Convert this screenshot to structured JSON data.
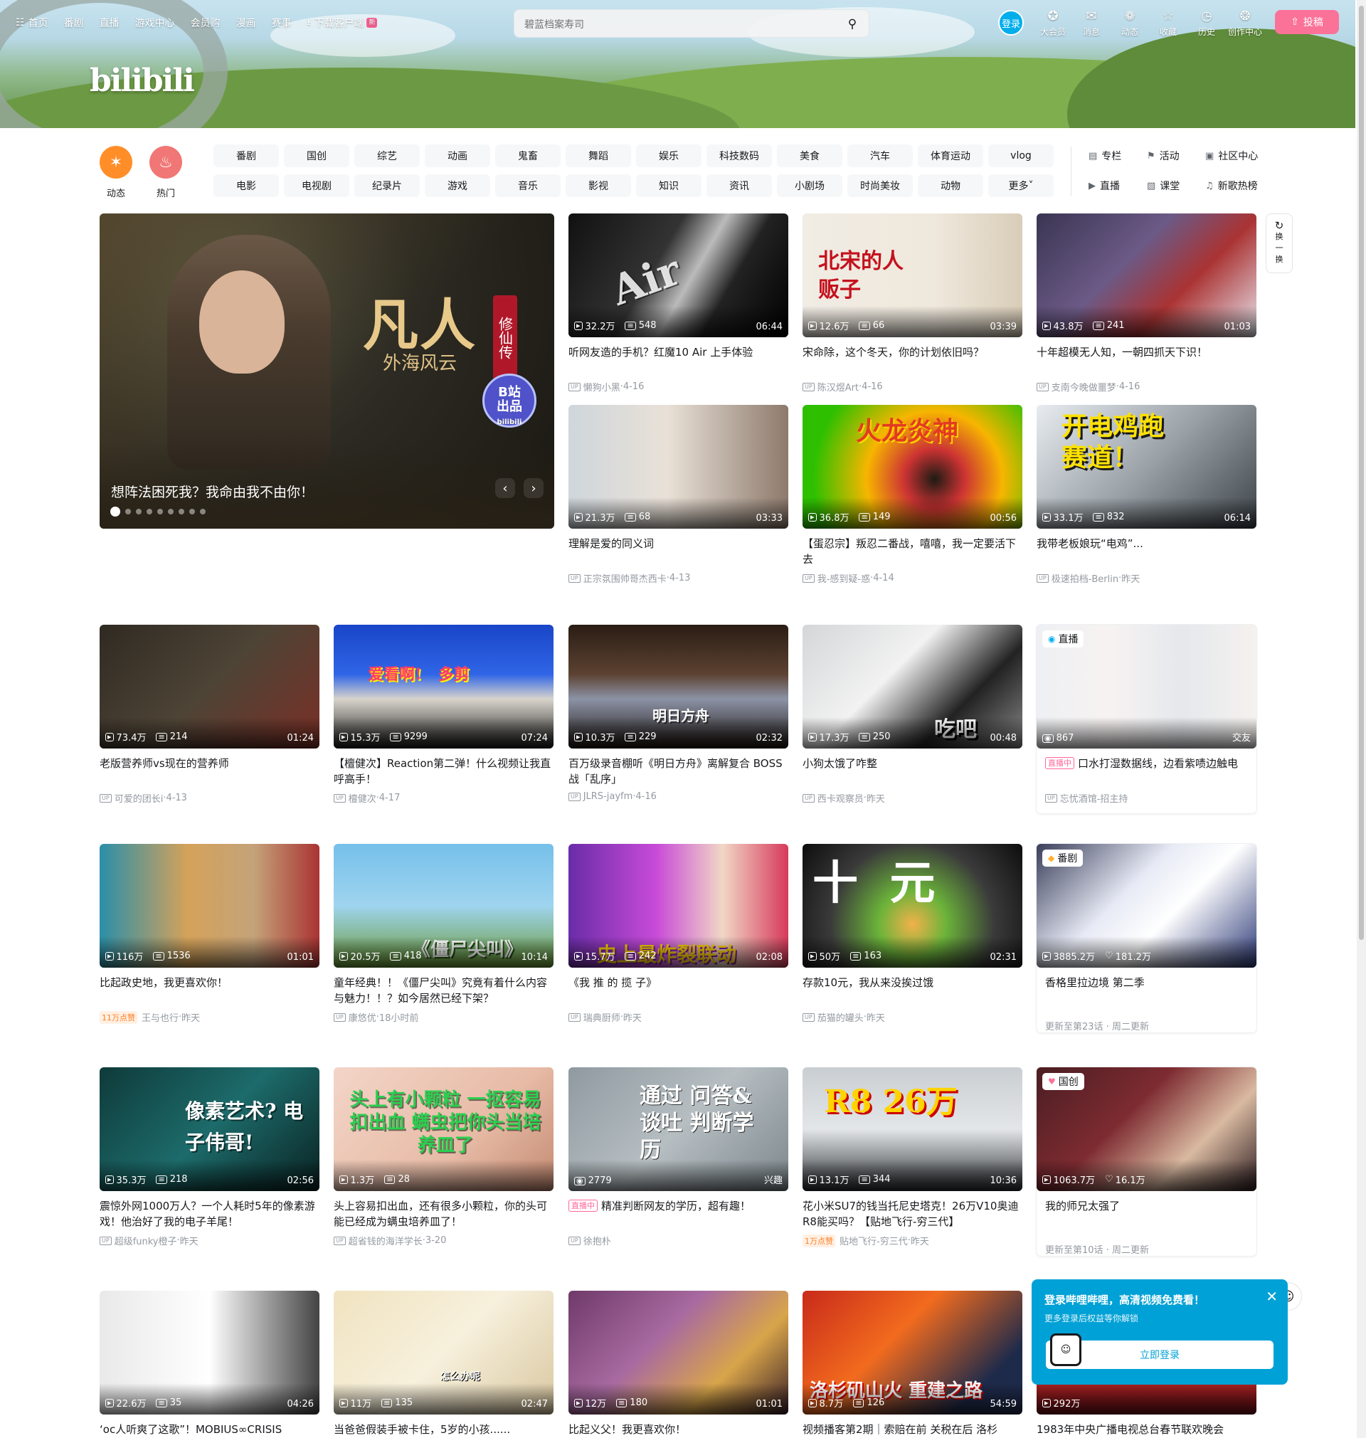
{
  "topnav": [
    {
      "icon": "tv-icon",
      "label": "首页"
    },
    {
      "icon": "",
      "label": "番剧"
    },
    {
      "icon": "",
      "label": "直播"
    },
    {
      "icon": "",
      "label": "游戏中心"
    },
    {
      "icon": "",
      "label": "会员购"
    },
    {
      "icon": "",
      "label": "漫画"
    },
    {
      "icon": "",
      "label": "赛事"
    },
    {
      "icon": "download-icon",
      "label": "下载客户端",
      "badge": "新"
    }
  ],
  "logo": "bilibili",
  "search": {
    "placeholder": "碧蓝档案寿司"
  },
  "login_label": "登录",
  "rightnav": [
    {
      "icon": "vip-icon",
      "label": "大会员"
    },
    {
      "icon": "message-icon",
      "label": "消息"
    },
    {
      "icon": "dynamic-icon",
      "label": "动态"
    },
    {
      "icon": "star-icon",
      "label": "收藏"
    },
    {
      "icon": "history-icon",
      "label": "历史"
    },
    {
      "icon": "bulb-icon",
      "label": "创作中心"
    }
  ],
  "upload_label": "投稿",
  "channels_big": [
    {
      "label": "动态",
      "color": "#ff8e29"
    },
    {
      "label": "热门",
      "color": "#f07775"
    }
  ],
  "channels": [
    "番剧",
    "国创",
    "综艺",
    "动画",
    "鬼畜",
    "舞蹈",
    "娱乐",
    "科技数码",
    "美食",
    "汽车",
    "体育运动",
    "vlog",
    "电影",
    "电视剧",
    "纪录片",
    "游戏",
    "音乐",
    "影视",
    "知识",
    "资讯",
    "小剧场",
    "时尚美妆",
    "动物",
    "更多"
  ],
  "side_links": [
    {
      "icon": "column-icon",
      "label": "专栏"
    },
    {
      "icon": "flag-icon",
      "label": "活动"
    },
    {
      "icon": "community-icon",
      "label": "社区中心"
    },
    {
      "icon": "live-icon",
      "label": "直播"
    },
    {
      "icon": "classroom-icon",
      "label": "课堂"
    },
    {
      "icon": "music-icon",
      "label": "新歌热榜"
    }
  ],
  "carousel": {
    "caption": "想阵法困死我？我命由我不由你！",
    "title_art": "凡人",
    "subtitle_art": "外海风云",
    "seal_text": "修仙传",
    "badge_line1": "B站",
    "badge_line2": "出品",
    "badge_small": "bilibili",
    "dots": 9,
    "active_dot": 0
  },
  "refresh": {
    "label1": "换",
    "label2": "一",
    "label3": "换"
  },
  "cards": [
    {
      "views": "32.2万",
      "danmaku": "548",
      "duration": "06:44",
      "title": "听网友造的手机？红魔10 Air 上手体验",
      "author": "懒狗小黑",
      "date": "4-16",
      "art": "phone",
      "bigtext": "Air"
    },
    {
      "views": "12.6万",
      "danmaku": "66",
      "duration": "03:39",
      "title": "宋命除，这个冬天，你的计划依旧吗？",
      "author": "陈汉煜Art",
      "date": "4-16",
      "art": "painter",
      "bigtext": "北宋的人贩子"
    },
    {
      "views": "43.8万",
      "danmaku": "241",
      "duration": "01:03",
      "title": "十年超模无人知，一朝四抓天下识！",
      "author": "支南今晚做噩梦",
      "date": "4-16",
      "art": "game1"
    },
    {
      "views": "21.3万",
      "danmaku": "68",
      "duration": "03:33",
      "title": "理解是爱的同义词",
      "author": "正宗氛围帅哥杰西卡",
      "date": "4-13",
      "art": "mirror"
    },
    {
      "views": "36.8万",
      "danmaku": "149",
      "duration": "00:56",
      "title": "【蛋忍宗】叛忍二番战，嘻嘻，我一定要活下去",
      "author": "我-感到疑-惑",
      "date": "4-14",
      "art": "fire",
      "bigtext": "火龙炎神"
    },
    {
      "views": "33.1万",
      "danmaku": "832",
      "duration": "06:14",
      "title": "我带老板娘玩“电鸡”...",
      "author": "极速拍档-Berlin",
      "date": "昨天",
      "art": "moto",
      "bigtext": "开电鸡跑赛道！"
    },
    {
      "views": "73.4万",
      "danmaku": "214",
      "duration": "01:24",
      "title": "老版营养师vs现在的营养师",
      "author": "可爱的团长i",
      "date": "4-13",
      "art": "soldier"
    },
    {
      "views": "15.3万",
      "danmaku": "9299",
      "duration": "07:24",
      "title": "【檀健次】Reaction第二弹！什么视频让我直呼高手！",
      "author": "檀健次",
      "date": "4-17",
      "art": "reaction",
      "bigtext": "爱看啊!   多剪"
    },
    {
      "views": "10.3万",
      "danmaku": "229",
      "duration": "02:32",
      "title": "百万级录音棚听《明日方舟》离解复合 BOSS战「乱序」",
      "author": "JLRS-jayfm",
      "date": "4-16",
      "art": "studio",
      "bigtext": "明日方舟"
    },
    {
      "views": "17.3万",
      "danmaku": "250",
      "duration": "00:48",
      "title": "小狗太饿了咋整",
      "author": "西卡观察员",
      "date": "昨天",
      "art": "dog",
      "bigtext": "吃吧"
    },
    {
      "special": "live",
      "tag": "直播",
      "views": "867",
      "right": "交友",
      "title": "口水打湿数据线，边看紫啧边触电",
      "live_badge": "直播中",
      "author": "忘忧酒馆-招主持",
      "art": "live"
    },
    {
      "views": "116万",
      "danmaku": "1536",
      "duration": "01:01",
      "title": "比起政史地，我更喜欢你！",
      "author": "王与也行",
      "date": "昨天",
      "hot": "11万点赞",
      "art": "cartoon"
    },
    {
      "views": "20.5万",
      "danmaku": "418",
      "duration": "10:14",
      "title": "童年经典！！《僵尸尖叫》究竟有着什么内容与魅力！！？如今居然已经下架？",
      "author": "康悠优",
      "date": "18小时前",
      "art": "zombie",
      "bigtext": "《僵尸尖叫》"
    },
    {
      "views": "15.7万",
      "danmaku": "242",
      "duration": "02:08",
      "title": "《我 推 的 揽 子》",
      "author": "瑞典厨师",
      "date": "昨天",
      "art": "anime",
      "bigtext": "史上最炸裂联动"
    },
    {
      "views": "50万",
      "danmaku": "163",
      "duration": "02:31",
      "title": "存款10元，我从来没挨过饿",
      "author": "茄猫的罐头",
      "date": "昨天",
      "art": "food",
      "bigtext": "十  元"
    },
    {
      "special": "bangumi",
      "tag": "番剧",
      "views": "3885.2万",
      "likes": "181.2万",
      "title": "香格里拉边境 第二季",
      "update": "更新至第23话 · 周二更新",
      "art": "rabbit"
    },
    {
      "views": "35.3万",
      "danmaku": "218",
      "duration": "02:56",
      "title": "震惊外网1000万人？一个人耗时5年的像素游戏！他治好了我的电子羊尾！",
      "author": "超级funky橙子",
      "date": "昨天",
      "art": "pixel",
      "bigtext": "像素艺术? 电子伟哥!"
    },
    {
      "views": "1.3万",
      "danmaku": "28",
      "duration": "",
      "title": "头上容易扣出血，还有很多小颗粒，你的头可能已经成为螨虫培养皿了！",
      "author": "超省钱的海洋学长",
      "date": "3-20",
      "art": "skin",
      "bigtext": "头上有小颗粒 一抠容易扣出血 螨虫把你头当培养皿了"
    },
    {
      "special": "livecard",
      "views": "2779",
      "right": "兴趣",
      "title": "精准判断网友的学历，超有趣！",
      "live_badge": "直播中",
      "author": "徐抱朴",
      "art": "chalk",
      "bigtext": "通过 问答&谈吐 判断学历"
    },
    {
      "views": "13.1万",
      "danmaku": "344",
      "duration": "10:36",
      "title": "花小米SU7的钱当托尼史塔克！26万V10奥迪R8能买吗？【贴地飞行-穷三代】",
      "author": "贴地飞行-穷三代",
      "date": "昨天",
      "hot": "1万点赞",
      "art": "car",
      "bigtext": "R8 26万"
    },
    {
      "special": "guochuang",
      "tag": "国创",
      "views": "1063.7万",
      "likes": "16.1万",
      "title": "我的师兄太强了",
      "update": "更新至第10话 · 周二更新",
      "art": "guochuang"
    },
    {
      "views": "22.6万",
      "danmaku": "35",
      "duration": "04:26",
      "title": "‘oc人听爽了这歌”！MOBIUS∞CRISIS",
      "author": "",
      "date": "",
      "art": "manga"
    },
    {
      "views": "11万",
      "danmaku": "135",
      "duration": "02:47",
      "title": "当爸爸假装手被卡住，5岁的小孩......",
      "author": "",
      "date": "",
      "art": "kid",
      "bigtext": "怎么办呢"
    },
    {
      "views": "12万",
      "danmaku": "180",
      "duration": "01:01",
      "title": "比起义父！我更喜欢你！",
      "author": "",
      "date": "",
      "art": "drama"
    },
    {
      "views": "8.7万",
      "danmaku": "126",
      "duration": "54:59",
      "title": "视频播客第2期｜索赔在前 关税在后 洛杉",
      "author": "",
      "date": "",
      "art": "news",
      "bigtext": "洛杉矶山火 重建之路"
    },
    {
      "views": "292万",
      "danmaku": "",
      "duration": "",
      "title": "1983年中央广播电视总台春节联欢晚会",
      "author": "",
      "date": "",
      "art": "gala"
    }
  ],
  "login_popup": {
    "title": "登录哔哩哔哩，高清视频免费看！",
    "subtitle": "更多登录后权益等你解锁",
    "button": "立即登录"
  },
  "colors": {
    "pink": "#fb7299",
    "blue": "#00aeec",
    "text": "#18191c",
    "muted": "#9499a0"
  }
}
